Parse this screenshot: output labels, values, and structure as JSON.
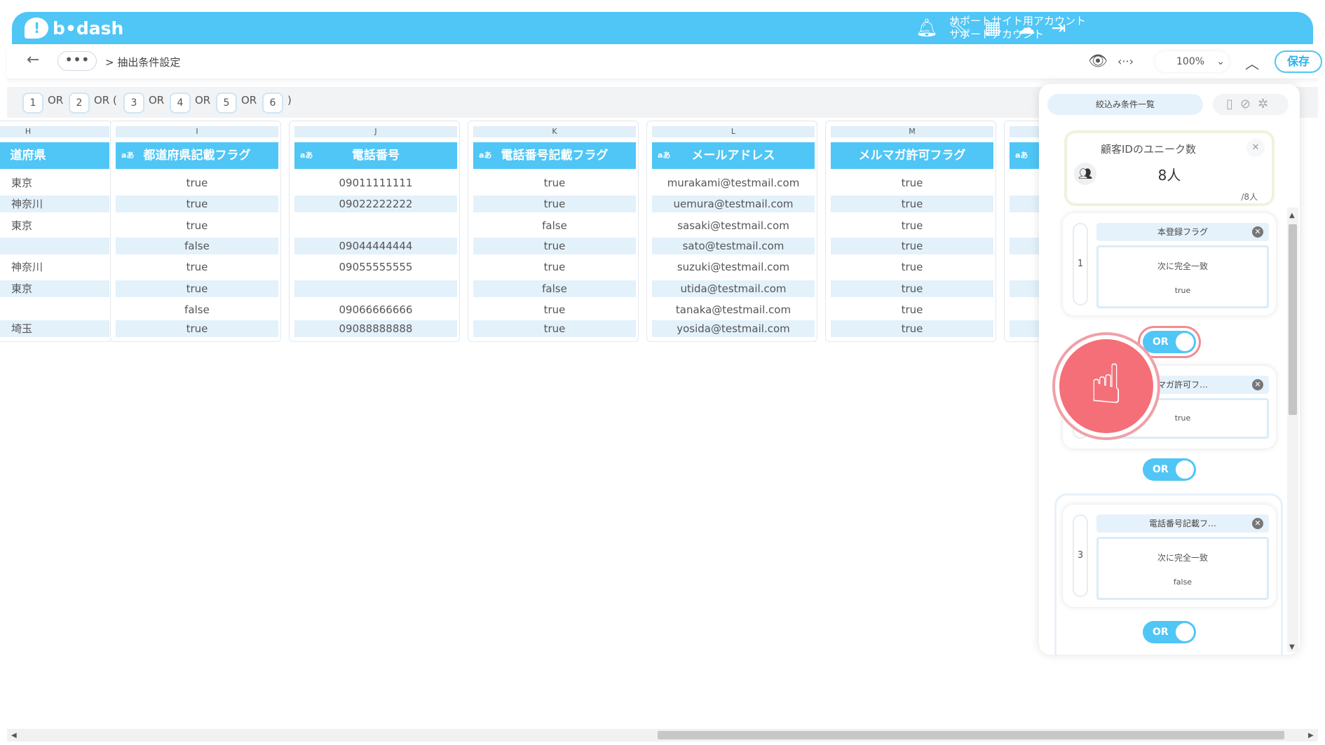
{
  "header": {
    "logo_text": "b•dash",
    "account_line1": "サポートサイト用アカウント",
    "account_line2": "サポートアカウント",
    "icons": [
      "bell-icon",
      "wrench-icon",
      "grid-icon",
      "support-icon",
      "logout-icon"
    ]
  },
  "subbar": {
    "back_label": "←",
    "more_label": "•••",
    "breadcrumb": "> 抽出条件設定",
    "zoom": "100%",
    "zoom_chevron": "⌄",
    "collapse_label": "︿",
    "save_label": "保存"
  },
  "expression": {
    "items": [
      {
        "type": "chip",
        "text": "1"
      },
      {
        "type": "op",
        "text": "OR"
      },
      {
        "type": "chip",
        "text": "2"
      },
      {
        "type": "op",
        "text": "OR ("
      },
      {
        "type": "chip",
        "text": "3"
      },
      {
        "type": "op",
        "text": "OR"
      },
      {
        "type": "chip",
        "text": "4"
      },
      {
        "type": "op",
        "text": "OR"
      },
      {
        "type": "chip",
        "text": "5"
      },
      {
        "type": "op",
        "text": "OR"
      },
      {
        "type": "chip",
        "text": "6"
      },
      {
        "type": "op",
        "text": ")"
      }
    ]
  },
  "table": {
    "columns": [
      {
        "letter": "H",
        "tag": "",
        "header": "道府県",
        "cells": [
          "東京",
          "神奈川",
          "東京",
          "",
          "神奈川",
          "東京",
          "",
          "埼玉"
        ]
      },
      {
        "letter": "I",
        "tag": "aあ",
        "header": "都道府県記載フラグ",
        "cells": [
          "true",
          "true",
          "true",
          "false",
          "true",
          "true",
          "false",
          "true"
        ]
      },
      {
        "letter": "J",
        "tag": "aあ",
        "header": "電話番号",
        "cells": [
          "09011111111",
          "09022222222",
          "",
          "09044444444",
          "09055555555",
          "",
          "09066666666",
          "09088888888"
        ]
      },
      {
        "letter": "K",
        "tag": "aあ",
        "header": "電話番号記載フラグ",
        "cells": [
          "true",
          "true",
          "false",
          "true",
          "true",
          "false",
          "true",
          "true"
        ]
      },
      {
        "letter": "L",
        "tag": "aあ",
        "header": "メールアドレス",
        "cells": [
          "murakami@testmail.com",
          "uemura@testmail.com",
          "sasaki@testmail.com",
          "sato@testmail.com",
          "suzuki@testmail.com",
          "utida@testmail.com",
          "tanaka@testmail.com",
          "yosida@testmail.com"
        ]
      },
      {
        "letter": "M",
        "tag": "",
        "header": "メルマガ許可フラグ",
        "cells": [
          "true",
          "true",
          "true",
          "true",
          "true",
          "true",
          "true",
          "true"
        ]
      },
      {
        "letter": "",
        "tag": "aあ",
        "header": "",
        "cells": [
          "",
          "",
          "",
          "",
          "",
          "",
          "",
          ""
        ]
      }
    ]
  },
  "panel": {
    "tab_label": "絞込み条件一覧",
    "unique": {
      "title": "顧客IDのユニーク数",
      "value": "8人",
      "total": "/8人"
    },
    "conditions": [
      {
        "num": "1",
        "field": "本登録フラグ",
        "operator": "次に完全一致",
        "value": "true"
      },
      {
        "num": "",
        "field": "マガ許可フ…",
        "operator": "",
        "value": "true"
      },
      {
        "num": "3",
        "field": "電話番号記載フ…",
        "operator": "次に完全一致",
        "value": "false"
      }
    ],
    "toggles": [
      "OR",
      "OR",
      "OR"
    ]
  }
}
